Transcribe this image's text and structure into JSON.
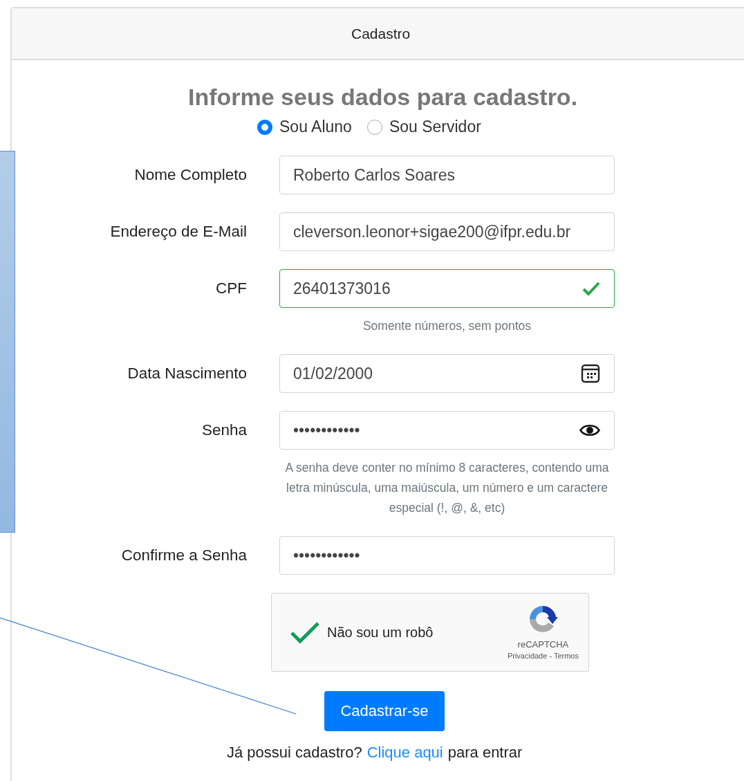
{
  "header": {
    "title": "Cadastro"
  },
  "heading": "Informe seus dados para cadastro.",
  "user_types": [
    {
      "label": "Sou Aluno",
      "selected": true
    },
    {
      "label": "Sou Servidor",
      "selected": false
    }
  ],
  "fields": [
    {
      "label": "Nome Completo",
      "value": "Roberto Carlos Soares",
      "kind": "text"
    },
    {
      "label": "Endereço de E-Mail",
      "value": "cleverson.leonor+sigae200@ifpr.edu.br",
      "kind": "text"
    },
    {
      "label": "CPF",
      "value": "26401373016",
      "kind": "text",
      "valid": true,
      "help": "Somente números, sem pontos"
    },
    {
      "label": "Data Nascimento",
      "value": "01/02/2000",
      "kind": "date"
    },
    {
      "label": "Senha",
      "value": "••••••••••••",
      "kind": "password-toggle",
      "help": "A senha deve conter no mínimo 8 caracteres, contendo uma letra minúscula, uma maiúscula, um número e um caractere especial (!, @, &, etc)"
    },
    {
      "label": "Confirme a Senha",
      "value": "••••••••••••",
      "kind": "password"
    }
  ],
  "captcha": {
    "label": "Não sou um robô",
    "checked": true,
    "brand": "reCAPTCHA",
    "links": "Privacidade - Termos"
  },
  "submit": "Cadastrar-se",
  "login_prompt": {
    "text": "Já possui cadastro?",
    "link": "Clique aqui",
    "after": "para entrar"
  }
}
